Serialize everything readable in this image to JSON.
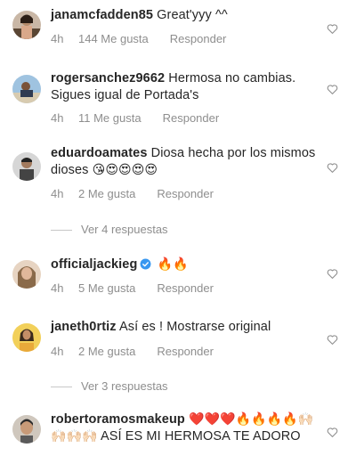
{
  "comments": [
    {
      "username": "janamcfadden85",
      "text": "Great'yyy ^^",
      "emoji": "",
      "time": "4h",
      "likes": "144 Me gusta",
      "reply": "Responder",
      "avatar": "avatar-janamcfadden85"
    },
    {
      "username": "rogersanchez9662",
      "text": "Hermosa no cambias. Sigues igual de Portada's",
      "emoji": "",
      "time": "4h",
      "likes": "11 Me gusta",
      "reply": "Responder",
      "avatar": "avatar-rogersanchez9662"
    },
    {
      "username": "eduardoamates",
      "text": "Diosa hecha por los mismos dioses",
      "emoji": "😘😍😍😍😍",
      "time": "4h",
      "likes": "2 Me gusta",
      "reply": "Responder",
      "avatar": "avatar-eduardoamates",
      "view_replies": "Ver 4 respuestas"
    },
    {
      "username": "officialjackieg",
      "verified": true,
      "text": "",
      "emoji": "🔥🔥",
      "time": "4h",
      "likes": "5 Me gusta",
      "reply": "Responder",
      "avatar": "avatar-officialjackieg"
    },
    {
      "username": "janeth0rtiz",
      "text": "Así es ! Mostrarse original",
      "emoji": "",
      "time": "4h",
      "likes": "2 Me gusta",
      "reply": "Responder",
      "avatar": "avatar-janeth0rtiz",
      "view_replies": "Ver 3 respuestas"
    },
    {
      "username": "robertoramosmakeup",
      "text_before": "",
      "emoji": "❤️❤️❤️🔥🔥🔥🔥🙌🏻🙌🏻🙌🏻🙌🏻",
      "text": "ASÍ ES MI HERMOSA TE ADORO",
      "avatar": "avatar-robertoramosmakeup"
    }
  ],
  "colors": {
    "text": "#262626",
    "muted": "#8e8e8e",
    "verified": "#3897f0"
  }
}
